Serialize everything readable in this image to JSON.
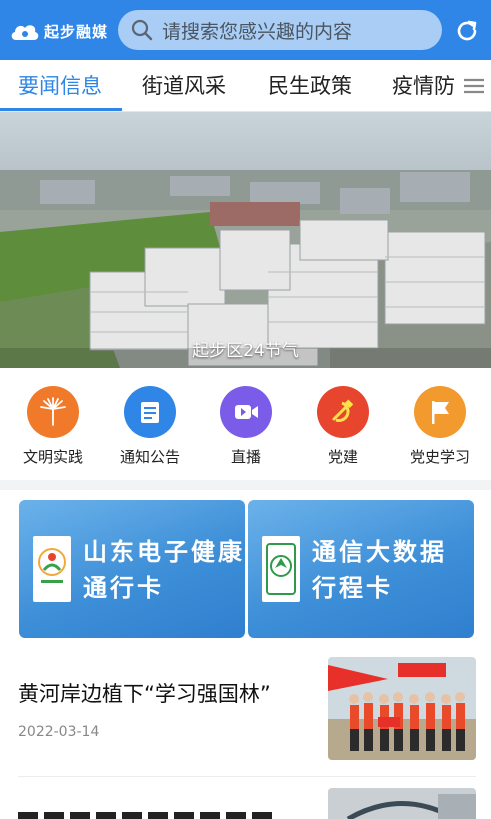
{
  "header": {
    "logo_text": "起步融媒",
    "search_placeholder": "请搜索您感兴趣的内容"
  },
  "tabs": [
    {
      "label": "要闻信息",
      "active": true
    },
    {
      "label": "街道风采",
      "active": false
    },
    {
      "label": "民生政策",
      "active": false
    },
    {
      "label": "疫情防",
      "active": false
    }
  ],
  "banner": {
    "caption": "起步区24节气"
  },
  "quick_links": [
    {
      "label": "文明实践",
      "icon": "civilization-practice-icon",
      "color": "#f07a2a"
    },
    {
      "label": "通知公告",
      "icon": "notice-icon",
      "color": "#2f86e6"
    },
    {
      "label": "直播",
      "icon": "live-video-icon",
      "color": "#7b5ce8"
    },
    {
      "label": "党建",
      "icon": "party-building-icon",
      "color": "#e8452e"
    },
    {
      "label": "党史学习",
      "icon": "flag-icon",
      "color": "#f39a2f"
    }
  ],
  "cards": [
    {
      "line1": "山东电子健康",
      "line2": "通行卡"
    },
    {
      "line1": "通信大数据",
      "line2": "行程卡"
    }
  ],
  "news": [
    {
      "title": "黄河岸边植下“学习强国林”",
      "date": "2022-03-14"
    }
  ],
  "colors": {
    "primary": "#2f86e6",
    "search_bg": "#a9cdf5"
  }
}
